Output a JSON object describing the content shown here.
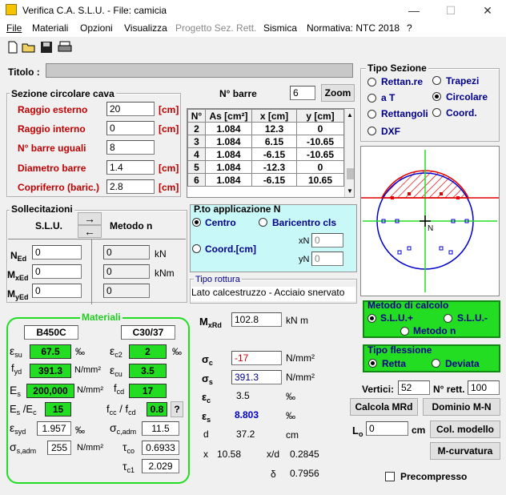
{
  "window": {
    "title": "Verifica C.A. S.L.U. - File: camicia",
    "minimize": "—",
    "maximize": "☐",
    "close": "✕"
  },
  "menu": [
    "File",
    "Materiali",
    "Opzioni",
    "Visualizza",
    "Progetto Sez. Rett.",
    "Sismica",
    "Normativa: NTC 2018",
    "?"
  ],
  "title_field": {
    "label": "Titolo :",
    "value": ""
  },
  "section": {
    "heading": "Sezione circolare cava",
    "rows": [
      {
        "label": "Raggio esterno",
        "value": "20",
        "unit": "[cm]"
      },
      {
        "label": "Raggio interno",
        "value": "0",
        "unit": "[cm]"
      },
      {
        "label": "N° barre uguali",
        "value": "8",
        "unit": ""
      },
      {
        "label": "Diametro barre",
        "value": "1.4",
        "unit": "[cm]"
      },
      {
        "label": "Copriferro (baric.)",
        "value": "2.8",
        "unit": "[cm]"
      }
    ]
  },
  "bars": {
    "label": "N° barre",
    "value": "6",
    "zoom": "Zoom",
    "headers": [
      "N°",
      "As [cm²]",
      "x [cm]",
      "y [cm]"
    ],
    "rows": [
      [
        "2",
        "1.084",
        "12.3",
        "0"
      ],
      [
        "3",
        "1.084",
        "6.15",
        "-10.65"
      ],
      [
        "4",
        "1.084",
        "-6.15",
        "-10.65"
      ],
      [
        "5",
        "1.084",
        "-12.3",
        "0"
      ],
      [
        "6",
        "1.084",
        "-6.15",
        "10.65"
      ]
    ]
  },
  "tipo_sezione": {
    "title": "Tipo Sezione",
    "options": [
      {
        "label": "Rettan.re",
        "selected": false
      },
      {
        "label": "Trapezi",
        "selected": false
      },
      {
        "label": "a T",
        "selected": false
      },
      {
        "label": "Circolare",
        "selected": true
      },
      {
        "label": "Rettangoli",
        "selected": false
      },
      {
        "label": "Coord.",
        "selected": false
      },
      {
        "label": "DXF",
        "selected": false
      }
    ]
  },
  "sollecitazioni": {
    "title": "Sollecitazioni",
    "slu": "S.L.U.",
    "metodo": "Metodo n",
    "rows": [
      {
        "sym": "N",
        "sub": "Ed",
        "v1": "0",
        "v2": "0",
        "unit": "kN"
      },
      {
        "sym": "M",
        "sub": "xEd",
        "v1": "0",
        "v2": "0",
        "unit": "kNm"
      },
      {
        "sym": "M",
        "sub": "yEd",
        "v1": "0",
        "v2": "0",
        "unit": ""
      }
    ],
    "arrow_right": "→",
    "arrow_left": "←"
  },
  "pto": {
    "title": "P.to applicazione N",
    "centro": "Centro",
    "baricentro": "Baricentro cls",
    "coord": "Coord.[cm]",
    "xn": "xN",
    "yn": "yN",
    "xn_val": "0",
    "yn_val": "0"
  },
  "rottura": {
    "title": "Tipo rottura",
    "value": "Lato calcestruzzo - Acciaio snervato"
  },
  "materiali": {
    "title": "Materiali",
    "steel": "B450C",
    "concrete": "C30/37",
    "esu": "67.5",
    "esu_u": "‰",
    "ec2": "2",
    "ec2_u": "‰",
    "fyd": "391.3",
    "fyd_u": "N/mm²",
    "ecu": "3.5",
    "es": "200,000",
    "es_u": "N/mm²",
    "fcd": "17",
    "esec": "15",
    "fccfcd": "0.8",
    "q": "?",
    "esyd": "1.957",
    "esyd_u": "‰",
    "sc_adm": "11.5",
    "ss_adm": "255",
    "ss_adm_u": "N/mm²",
    "tco": "0.6933",
    "tc1": "2.029"
  },
  "results": {
    "mxrd_val": "102.8",
    "mxrd_u": "kN m",
    "sc": "-17",
    "sc_u": "N/mm²",
    "ss": "391.3",
    "ss_u": "N/mm²",
    "ec": "3.5",
    "ec_u": "‰",
    "es": "8.803",
    "es_u": "‰",
    "d": "37.2",
    "d_u": "cm",
    "x": "10.58",
    "xd": "0.2845",
    "delta": "0.7956"
  },
  "metodo": {
    "title": "Metodo di calcolo",
    "slu_plus": "S.L.U.+",
    "slu_minus": "S.L.U.-",
    "metodo_n": "Metodo n"
  },
  "flessione": {
    "title": "Tipo flessione",
    "retta": "Retta",
    "deviata": "Deviata"
  },
  "vertici": {
    "label": "Vertici:",
    "value": "52",
    "nrett_label": "N° rett.",
    "nrett": "100"
  },
  "buttons": {
    "calcola": "Calcola MRd",
    "dominio": "Dominio M-N",
    "col": "Col. modello",
    "mcurv": "M-curvatura"
  },
  "lo": {
    "label": "L",
    "sub": "o",
    "value": "0",
    "unit": "cm"
  },
  "precompresso": "Precompresso",
  "diagram": {
    "n_label": "N"
  },
  "colors": {
    "green": "#22dd22",
    "red": "#e00000",
    "blue": "#0000cc"
  }
}
